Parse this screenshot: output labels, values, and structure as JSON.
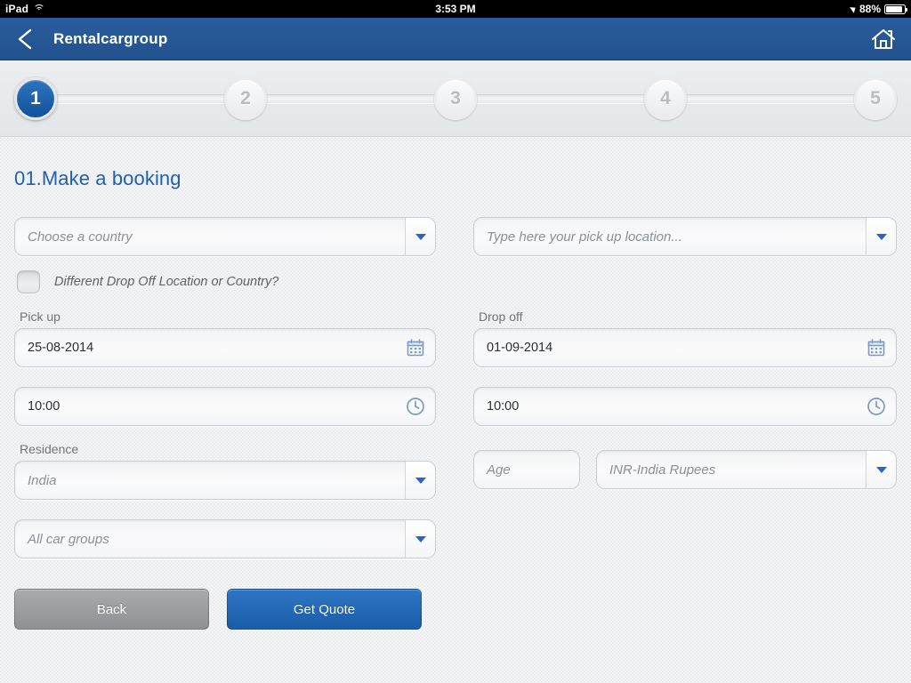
{
  "status_bar": {
    "device_label": "iPad",
    "wifi_icon": "wifi-icon",
    "time": "3:53 PM",
    "location_icon": "location-arrow-icon",
    "battery_percent": "88%",
    "battery_icon": "battery-icon",
    "battery_level": 88
  },
  "app_bar": {
    "back_icon": "chevron-left-icon",
    "title": "Rentalcargroup",
    "home_icon": "home-icon",
    "background_color": "#22528d"
  },
  "stepper": {
    "active_index": 1,
    "active_color": "#13519b",
    "steps": [
      {
        "label": "1"
      },
      {
        "label": "2"
      },
      {
        "label": "3"
      },
      {
        "label": "4"
      },
      {
        "label": "5"
      }
    ]
  },
  "form": {
    "title": "01.Make a booking",
    "title_color": "#1f5fad",
    "country": {
      "label": "",
      "placeholder": "Choose a country",
      "value": "",
      "arrow_icon": "chevron-down-icon"
    },
    "pickup_location": {
      "label": "",
      "placeholder": "Type here your pick up location...",
      "value": "",
      "arrow_icon": "chevron-down-icon"
    },
    "different_dropoff": {
      "label": "Different Drop Off Location or Country?",
      "checked": false
    },
    "pickup": {
      "label": "Pick up",
      "date_value": "25-08-2014",
      "date_icon": "calendar-icon",
      "time_value": "10:00",
      "time_icon": "clock-icon"
    },
    "dropoff": {
      "label": "Drop off",
      "date_value": "01-09-2014",
      "date_icon": "calendar-icon",
      "time_value": "10:00",
      "time_icon": "clock-icon"
    },
    "residence": {
      "label": "Residence",
      "value": "India",
      "arrow_icon": "chevron-down-icon"
    },
    "age": {
      "placeholder": "Age",
      "value": ""
    },
    "currency": {
      "value": "INR-India Rupees",
      "arrow_icon": "chevron-down-icon"
    },
    "car_group": {
      "value": "All car groups",
      "arrow_icon": "chevron-down-icon"
    },
    "buttons": {
      "back": "Back",
      "get_quote": "Get Quote",
      "primary_color": "#1b5ca8",
      "secondary_color": "#8e9093"
    }
  }
}
